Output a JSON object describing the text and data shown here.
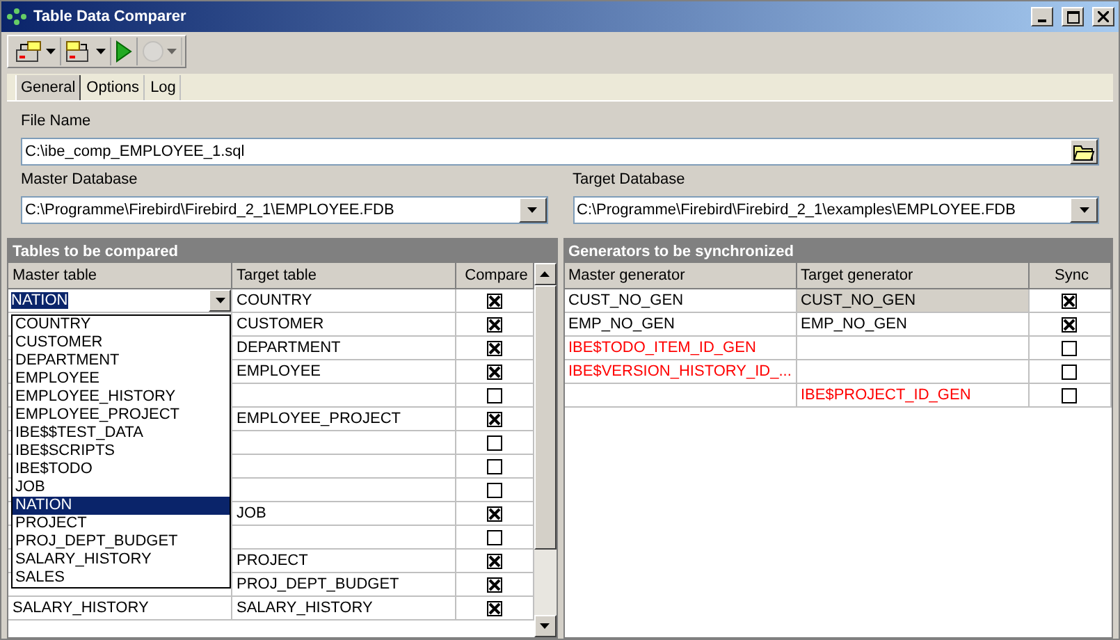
{
  "window": {
    "title": "Table Data Comparer"
  },
  "toolbar": [
    {
      "kind": "export",
      "dropdown": true,
      "disabled": false
    },
    {
      "kind": "import",
      "dropdown": true,
      "disabled": false
    },
    {
      "kind": "run",
      "dropdown": false,
      "disabled": false
    },
    {
      "kind": "stop",
      "dropdown": true,
      "disabled": true
    }
  ],
  "tabs": [
    {
      "label": "General",
      "selected": true
    },
    {
      "label": "Options",
      "selected": false
    },
    {
      "label": "Log",
      "selected": false
    }
  ],
  "file_name": {
    "label": "File Name",
    "value": "C:\\ibe_comp_EMPLOYEE_1.sql"
  },
  "master_database": {
    "label": "Master Database",
    "value": "C:\\Programme\\Firebird\\Firebird_2_1\\EMPLOYEE.FDB"
  },
  "target_database": {
    "label": "Target Database",
    "value": "C:\\Programme\\Firebird\\Firebird_2_1\\examples\\EMPLOYEE.FDB"
  },
  "tables": {
    "title": "Tables to be compared",
    "columns": [
      "Master table",
      "Target table",
      "Compare"
    ],
    "editor": {
      "value": "NATION",
      "open": true,
      "options": [
        {
          "label": "COUNTRY",
          "selected": false
        },
        {
          "label": "CUSTOMER",
          "selected": false
        },
        {
          "label": "DEPARTMENT",
          "selected": false
        },
        {
          "label": "EMPLOYEE",
          "selected": false
        },
        {
          "label": "EMPLOYEE_HISTORY",
          "selected": false
        },
        {
          "label": "EMPLOYEE_PROJECT",
          "selected": false
        },
        {
          "label": "IBE$$TEST_DATA",
          "selected": false
        },
        {
          "label": "IBE$SCRIPTS",
          "selected": false
        },
        {
          "label": "IBE$TODO",
          "selected": false
        },
        {
          "label": "JOB",
          "selected": false
        },
        {
          "label": "NATION",
          "selected": true
        },
        {
          "label": "PROJECT",
          "selected": false
        },
        {
          "label": "PROJ_DEPT_BUDGET",
          "selected": false
        },
        {
          "label": "SALARY_HISTORY",
          "selected": false
        },
        {
          "label": "SALES",
          "selected": false
        }
      ]
    },
    "rows": [
      {
        "target": "COUNTRY",
        "checked": true
      },
      {
        "target": "CUSTOMER",
        "checked": true
      },
      {
        "target": "DEPARTMENT",
        "checked": true
      },
      {
        "target": "EMPLOYEE",
        "checked": true
      },
      {
        "checked": false
      },
      {
        "target": "EMPLOYEE_PROJECT",
        "checked": true
      },
      {
        "checked": false
      },
      {
        "checked": false
      },
      {
        "checked": false
      },
      {
        "target": "JOB",
        "checked": true
      },
      {
        "checked": false
      },
      {
        "target": "PROJECT",
        "checked": true
      },
      {
        "target": "PROJ_DEPT_BUDGET",
        "checked": true
      },
      {
        "master": "SALARY_HISTORY",
        "target": "SALARY_HISTORY",
        "checked": true
      }
    ]
  },
  "generators": {
    "title": "Generators to be synchronized",
    "columns": [
      "Master generator",
      "Target generator",
      "Sync"
    ],
    "rows": [
      {
        "master": "CUST_NO_GEN",
        "target": "CUST_NO_GEN",
        "checked": true,
        "color": "#000000",
        "selected": true
      },
      {
        "master": "EMP_NO_GEN",
        "target": "EMP_NO_GEN",
        "checked": true,
        "color": "#000000",
        "selected": false
      },
      {
        "master": "IBE$TODO_ITEM_ID_GEN",
        "checked": false,
        "color": "#ff0000",
        "selected": false
      },
      {
        "master": "IBE$VERSION_HISTORY_ID_...",
        "checked": false,
        "color": "#ff0000",
        "selected": false
      },
      {
        "target": "IBE$PROJECT_ID_GEN",
        "checked": false,
        "color": "#ff0000",
        "selected": false
      }
    ]
  }
}
